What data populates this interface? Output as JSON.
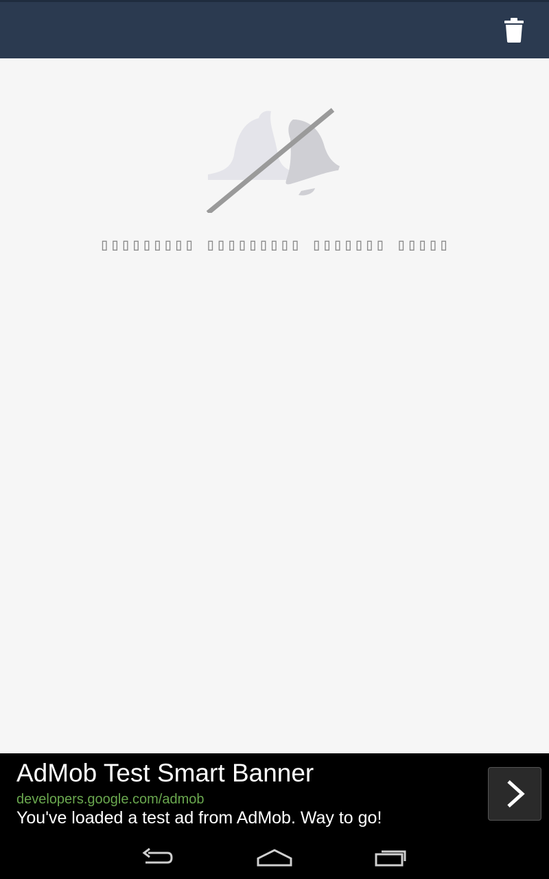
{
  "toolbar": {
    "background": "#2b3a50",
    "actions": [
      {
        "icon": "trash-icon"
      }
    ]
  },
  "empty_state": {
    "icon": "bell-off-icon",
    "message": "▯▯▯▯▯▯▯▯▯ ▯▯▯▯▯▯▯▯▯ ▯▯▯▯▯▯▯ ▯▯▯▯▯"
  },
  "ad": {
    "title": "AdMob Test Smart Banner",
    "url": "developers.google.com/admob",
    "description": "You've loaded a test ad from AdMob. Way to go!",
    "url_color": "#6aa84f",
    "action_icon": "chevron-right-icon"
  },
  "navbar": {
    "buttons": [
      {
        "icon": "back-icon"
      },
      {
        "icon": "home-icon"
      },
      {
        "icon": "recent-apps-icon"
      }
    ]
  }
}
